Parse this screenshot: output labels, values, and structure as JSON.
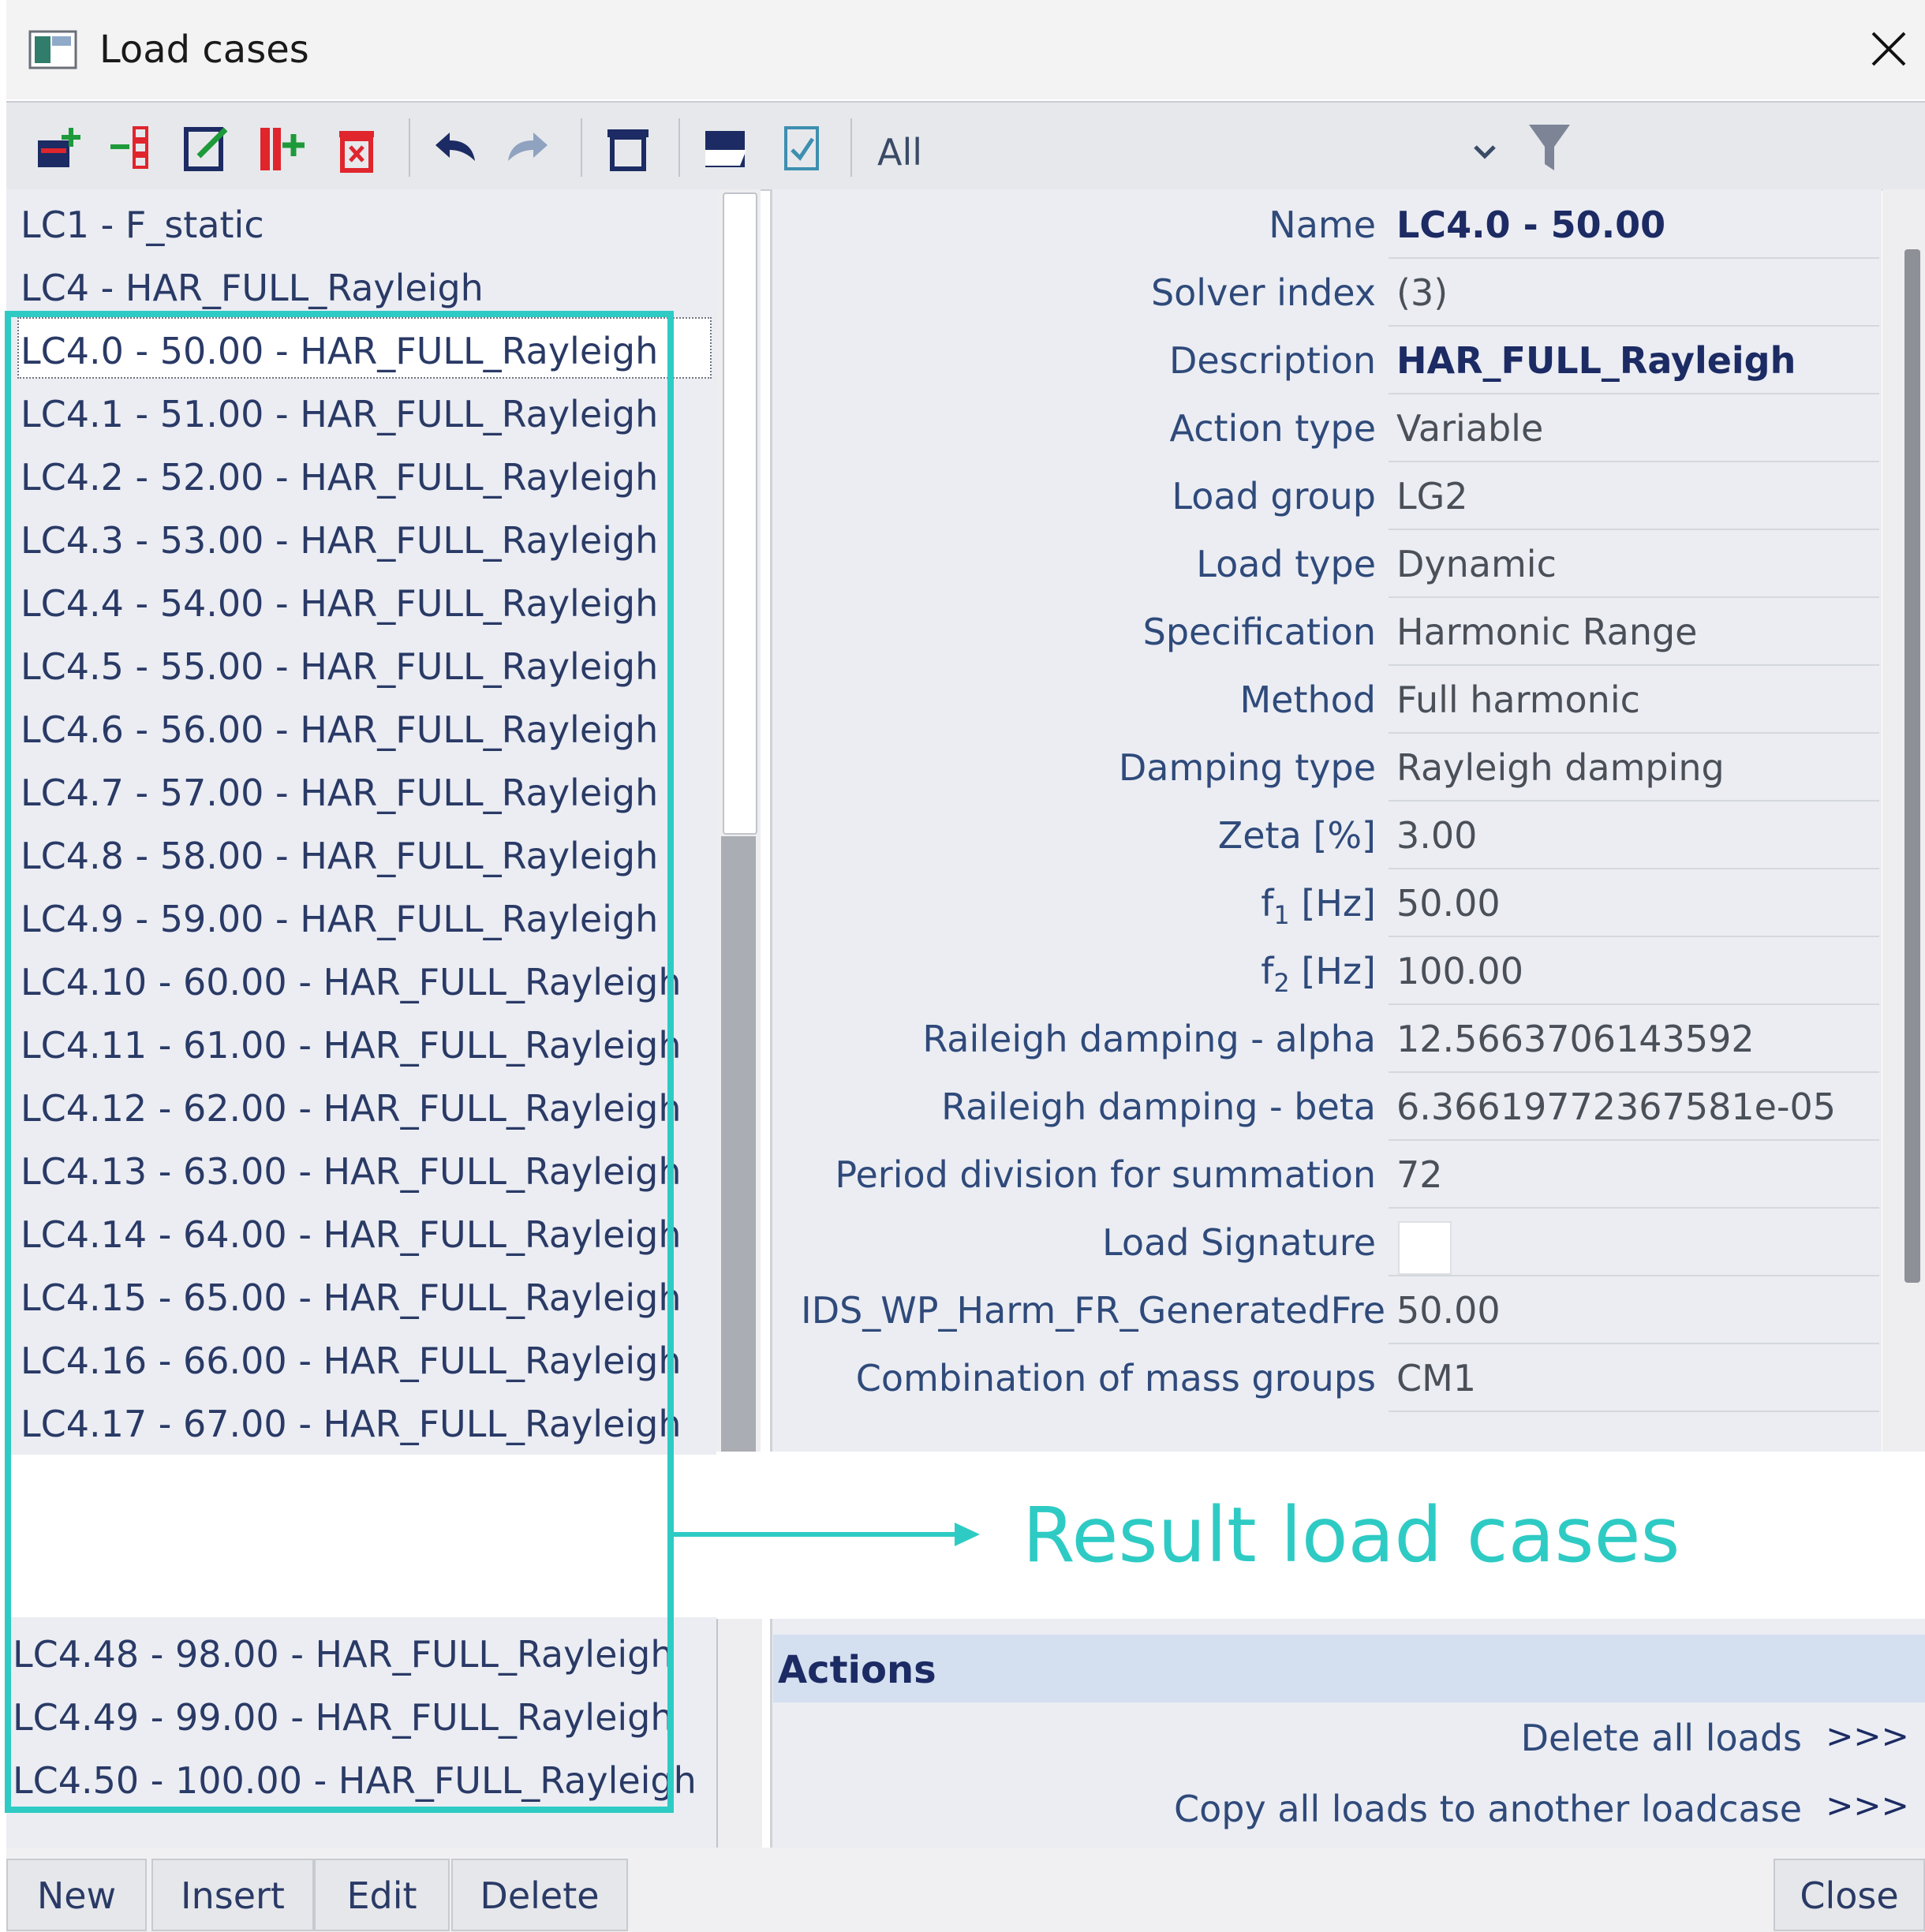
{
  "window": {
    "title": "Load cases"
  },
  "toolbar": {
    "icons": [
      "new-loadcase-icon",
      "insert-icon",
      "edit-icon",
      "insert-after-icon",
      "delete-icon",
      "undo-icon",
      "redo-icon",
      "table-icon",
      "open-icon",
      "check-icon"
    ],
    "filter_value": "All"
  },
  "load_cases_top": [
    "LC1 - F_static",
    "LC4 - HAR_FULL_Rayleigh",
    "LC4.0 - 50.00 - HAR_FULL_Rayleigh",
    "LC4.1 - 51.00 - HAR_FULL_Rayleigh",
    "LC4.2 - 52.00 - HAR_FULL_Rayleigh",
    "LC4.3 - 53.00 - HAR_FULL_Rayleigh",
    "LC4.4 - 54.00 - HAR_FULL_Rayleigh",
    "LC4.5 - 55.00 - HAR_FULL_Rayleigh",
    "LC4.6 - 56.00 - HAR_FULL_Rayleigh",
    "LC4.7 - 57.00 - HAR_FULL_Rayleigh",
    "LC4.8 - 58.00 - HAR_FULL_Rayleigh",
    "LC4.9 - 59.00 - HAR_FULL_Rayleigh",
    "LC4.10 - 60.00 - HAR_FULL_Rayleigh",
    "LC4.11 - 61.00 - HAR_FULL_Rayleigh",
    "LC4.12 - 62.00 - HAR_FULL_Rayleigh",
    "LC4.13 - 63.00 - HAR_FULL_Rayleigh",
    "LC4.14 - 64.00 - HAR_FULL_Rayleigh",
    "LC4.15 - 65.00 - HAR_FULL_Rayleigh",
    "LC4.16 - 66.00 - HAR_FULL_Rayleigh",
    "LC4.17 - 67.00 - HAR_FULL_Rayleigh"
  ],
  "load_cases_bottom": [
    "LC4.48 - 98.00 - HAR_FULL_Rayleigh",
    "LC4.49 - 99.00 - HAR_FULL_Rayleigh",
    "LC4.50 - 100.00 - HAR_FULL_Rayleigh"
  ],
  "properties": {
    "name": {
      "label": "Name",
      "value": "LC4.0 - 50.00"
    },
    "solver_index": {
      "label": "Solver index",
      "value": "(3)"
    },
    "description": {
      "label": "Description",
      "value": "HAR_FULL_Rayleigh"
    },
    "action_type": {
      "label": "Action type",
      "value": "Variable"
    },
    "load_group": {
      "label": "Load group",
      "value": "LG2"
    },
    "load_type": {
      "label": "Load type",
      "value": "Dynamic"
    },
    "specification": {
      "label": "Specification",
      "value": "Harmonic Range"
    },
    "method": {
      "label": "Method",
      "value": "Full harmonic"
    },
    "damping_type": {
      "label": "Damping type",
      "value": "Rayleigh damping"
    },
    "zeta": {
      "label": "Zeta [%]",
      "value": "3.00"
    },
    "f1": {
      "label_main": "f",
      "label_sub": "1",
      "label_unit": " [Hz]",
      "value": "50.00"
    },
    "f2": {
      "label_main": "f",
      "label_sub": "2",
      "label_unit": " [Hz]",
      "value": "100.00"
    },
    "alpha": {
      "label": "Raileigh damping - alpha",
      "value": "12.5663706143592"
    },
    "beta": {
      "label": "Raileigh damping - beta",
      "value": "6.36619772367581e-05"
    },
    "period_division": {
      "label": "Period division for summation",
      "value": "72"
    },
    "load_signature": {
      "label": "Load Signature"
    },
    "generated_freq": {
      "label": "IDS_WP_Harm_FR_GeneratedFre",
      "value": "50.00"
    },
    "mass_groups": {
      "label": "Combination of mass groups",
      "value": "CM1"
    }
  },
  "actions": {
    "title": "Actions",
    "items": [
      {
        "label": "Delete all loads",
        "button": ">>>"
      },
      {
        "label": "Copy all loads to another loadcase",
        "button": ">>>"
      }
    ]
  },
  "buttons": {
    "new": "New",
    "insert": "Insert",
    "edit": "Edit",
    "delete": "Delete",
    "close": "Close"
  },
  "annotation": {
    "text": "Result load cases",
    "color": "#2ecbc4"
  },
  "colors": {
    "accent": "#2ecbc4",
    "delete_red": "#e0252c",
    "label_blue": "#2f4a7a"
  }
}
